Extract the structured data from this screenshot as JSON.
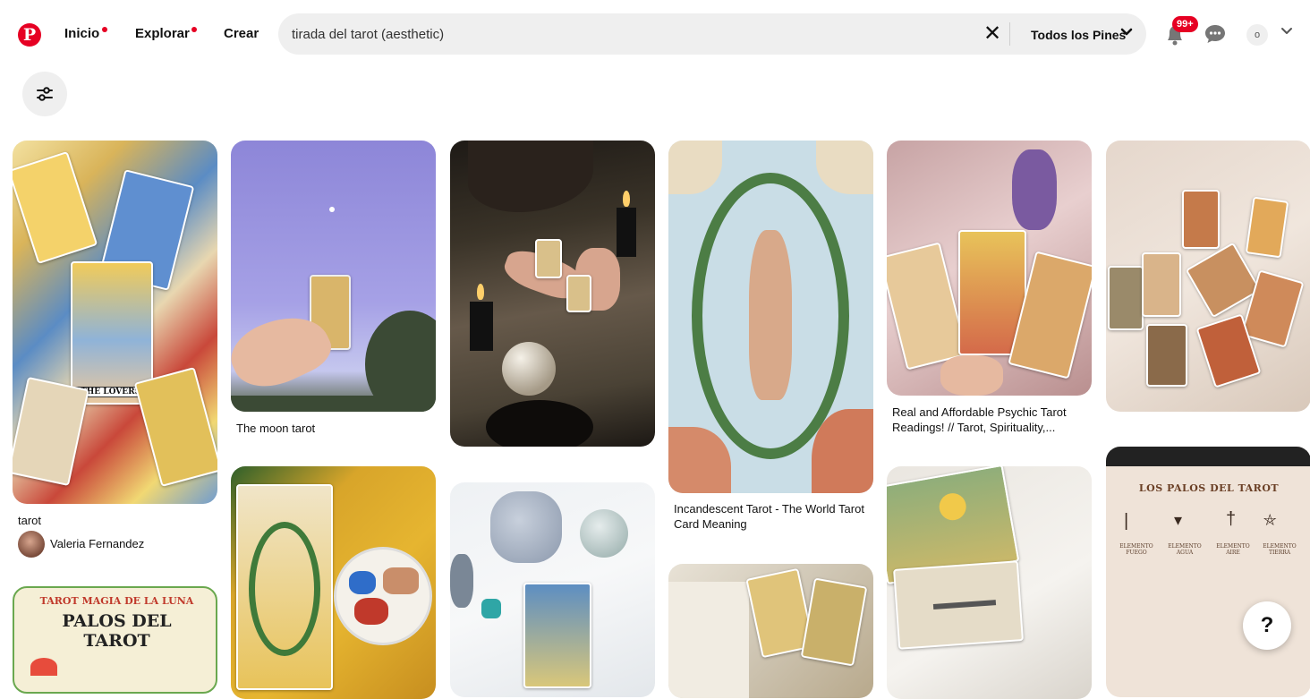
{
  "header": {
    "logo_letter": "P",
    "nav": [
      {
        "label": "Inicio",
        "has_dot": true
      },
      {
        "label": "Explorar",
        "has_dot": true
      },
      {
        "label": "Crear",
        "has_dot": false
      }
    ],
    "search": {
      "value": "tirada del tarot (aesthetic)",
      "clear_glyph": "✕",
      "scope_label": "Todos los Pines",
      "scope_chevron": "⌄"
    },
    "notifications_badge": "99+",
    "account_initial": "o",
    "account_chevron": "⌄"
  },
  "filters_icon": "sliders-icon",
  "pins": [
    {
      "title": "tarot",
      "author": "Valeria Fernandez"
    },
    {
      "title": "The moon tarot"
    },
    {
      "title": "Incandescent Tarot - The World Tarot Card Meaning"
    },
    {
      "title": "Real and Affordable Psychic Tarot Readings! // Tarot, Spirituality,..."
    }
  ],
  "image_text": {
    "lovers_card": "THE LOVERS.",
    "magia_banner": "TAROT MAGIA DE LA LUNA",
    "palos_del": "PALOS DEL",
    "tarot_word": "TAROT",
    "palos_header": "LOS PALOS DEL TAROT",
    "elements": [
      "ELEMENTO FUEGO",
      "ELEMENTO AGUA",
      "ELEMENTO AIRE",
      "ELEMENTO TIERRA"
    ]
  },
  "help_label": "?",
  "colors": {
    "brand_red": "#e60023",
    "search_bg": "#efefef"
  }
}
